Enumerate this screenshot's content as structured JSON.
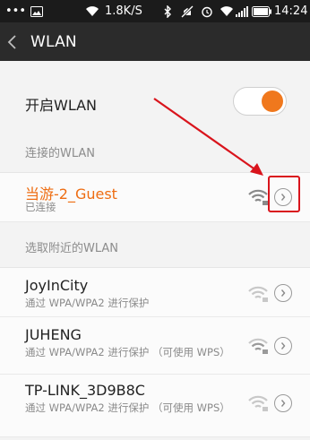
{
  "status_bar": {
    "dots": "•••",
    "speed": "1.8K/S",
    "time": "14:24"
  },
  "header": {
    "title": "WLAN",
    "back_icon": "back-chevron-icon"
  },
  "toggle": {
    "label": "开启WLAN",
    "state": "on",
    "accent_color": "#f0781d"
  },
  "connected_section": {
    "label": "连接的WLAN",
    "network": {
      "name": "当游-2_Guest",
      "status": "已连接",
      "name_color": "#ee6d12"
    }
  },
  "nearby_section": {
    "label": "选取附近的WLAN",
    "networks": [
      {
        "name": "JoyInCity",
        "subtitle": "通过 WPA/WPA2 进行保护"
      },
      {
        "name": "JUHENG",
        "subtitle": "通过 WPA/WPA2 进行保护 （可使用 WPS）"
      },
      {
        "name": "TP-LINK_3D9B8C",
        "subtitle": "通过 WPA/WPA2 进行保护 （可使用 WPS）"
      }
    ]
  },
  "annotation": {
    "arrow_color": "#d9141c"
  }
}
